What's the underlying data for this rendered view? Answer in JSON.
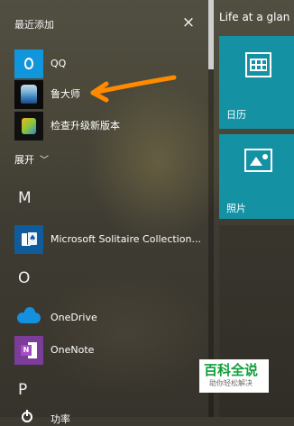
{
  "start_menu": {
    "recently_added": "最近添加",
    "close_icon": "×",
    "apps": [
      {
        "label": "QQ",
        "icon": "qq-icon"
      },
      {
        "label": "鲁大师",
        "icon": "ludashi-icon"
      },
      {
        "label": "检查升级新版本",
        "icon": "update-icon"
      }
    ],
    "expand_label": "展开",
    "expand_icon": "﹀",
    "groups": [
      {
        "letter": "M",
        "items": [
          {
            "label": "Microsoft Solitaire Collection...",
            "icon": "solitaire-icon"
          }
        ]
      },
      {
        "letter": "O",
        "items": [
          {
            "label": "OneDrive",
            "icon": "onedrive-icon"
          },
          {
            "label": "OneNote",
            "icon": "onenote-icon"
          }
        ]
      },
      {
        "letter": "P",
        "items": [
          {
            "label": "功率",
            "icon": "power-icon"
          }
        ]
      }
    ],
    "scroll_position": 0.17
  },
  "right_panel": {
    "title": "Life at a glan",
    "tiles": [
      {
        "label": "日历",
        "icon": "calendar-icon",
        "color": "#1491a3"
      },
      {
        "label": "照片",
        "icon": "photos-icon",
        "color": "#1491a3"
      }
    ]
  },
  "annotation": {
    "arrow_color": "#ff8a00"
  },
  "watermark": {
    "main": "百科全说",
    "sub": "助你轻松解决"
  },
  "colors": {
    "qq": "#1296db",
    "onedrive": "#1490df",
    "onenote": "#7c3c99",
    "tile_teal": "#1491a3"
  }
}
